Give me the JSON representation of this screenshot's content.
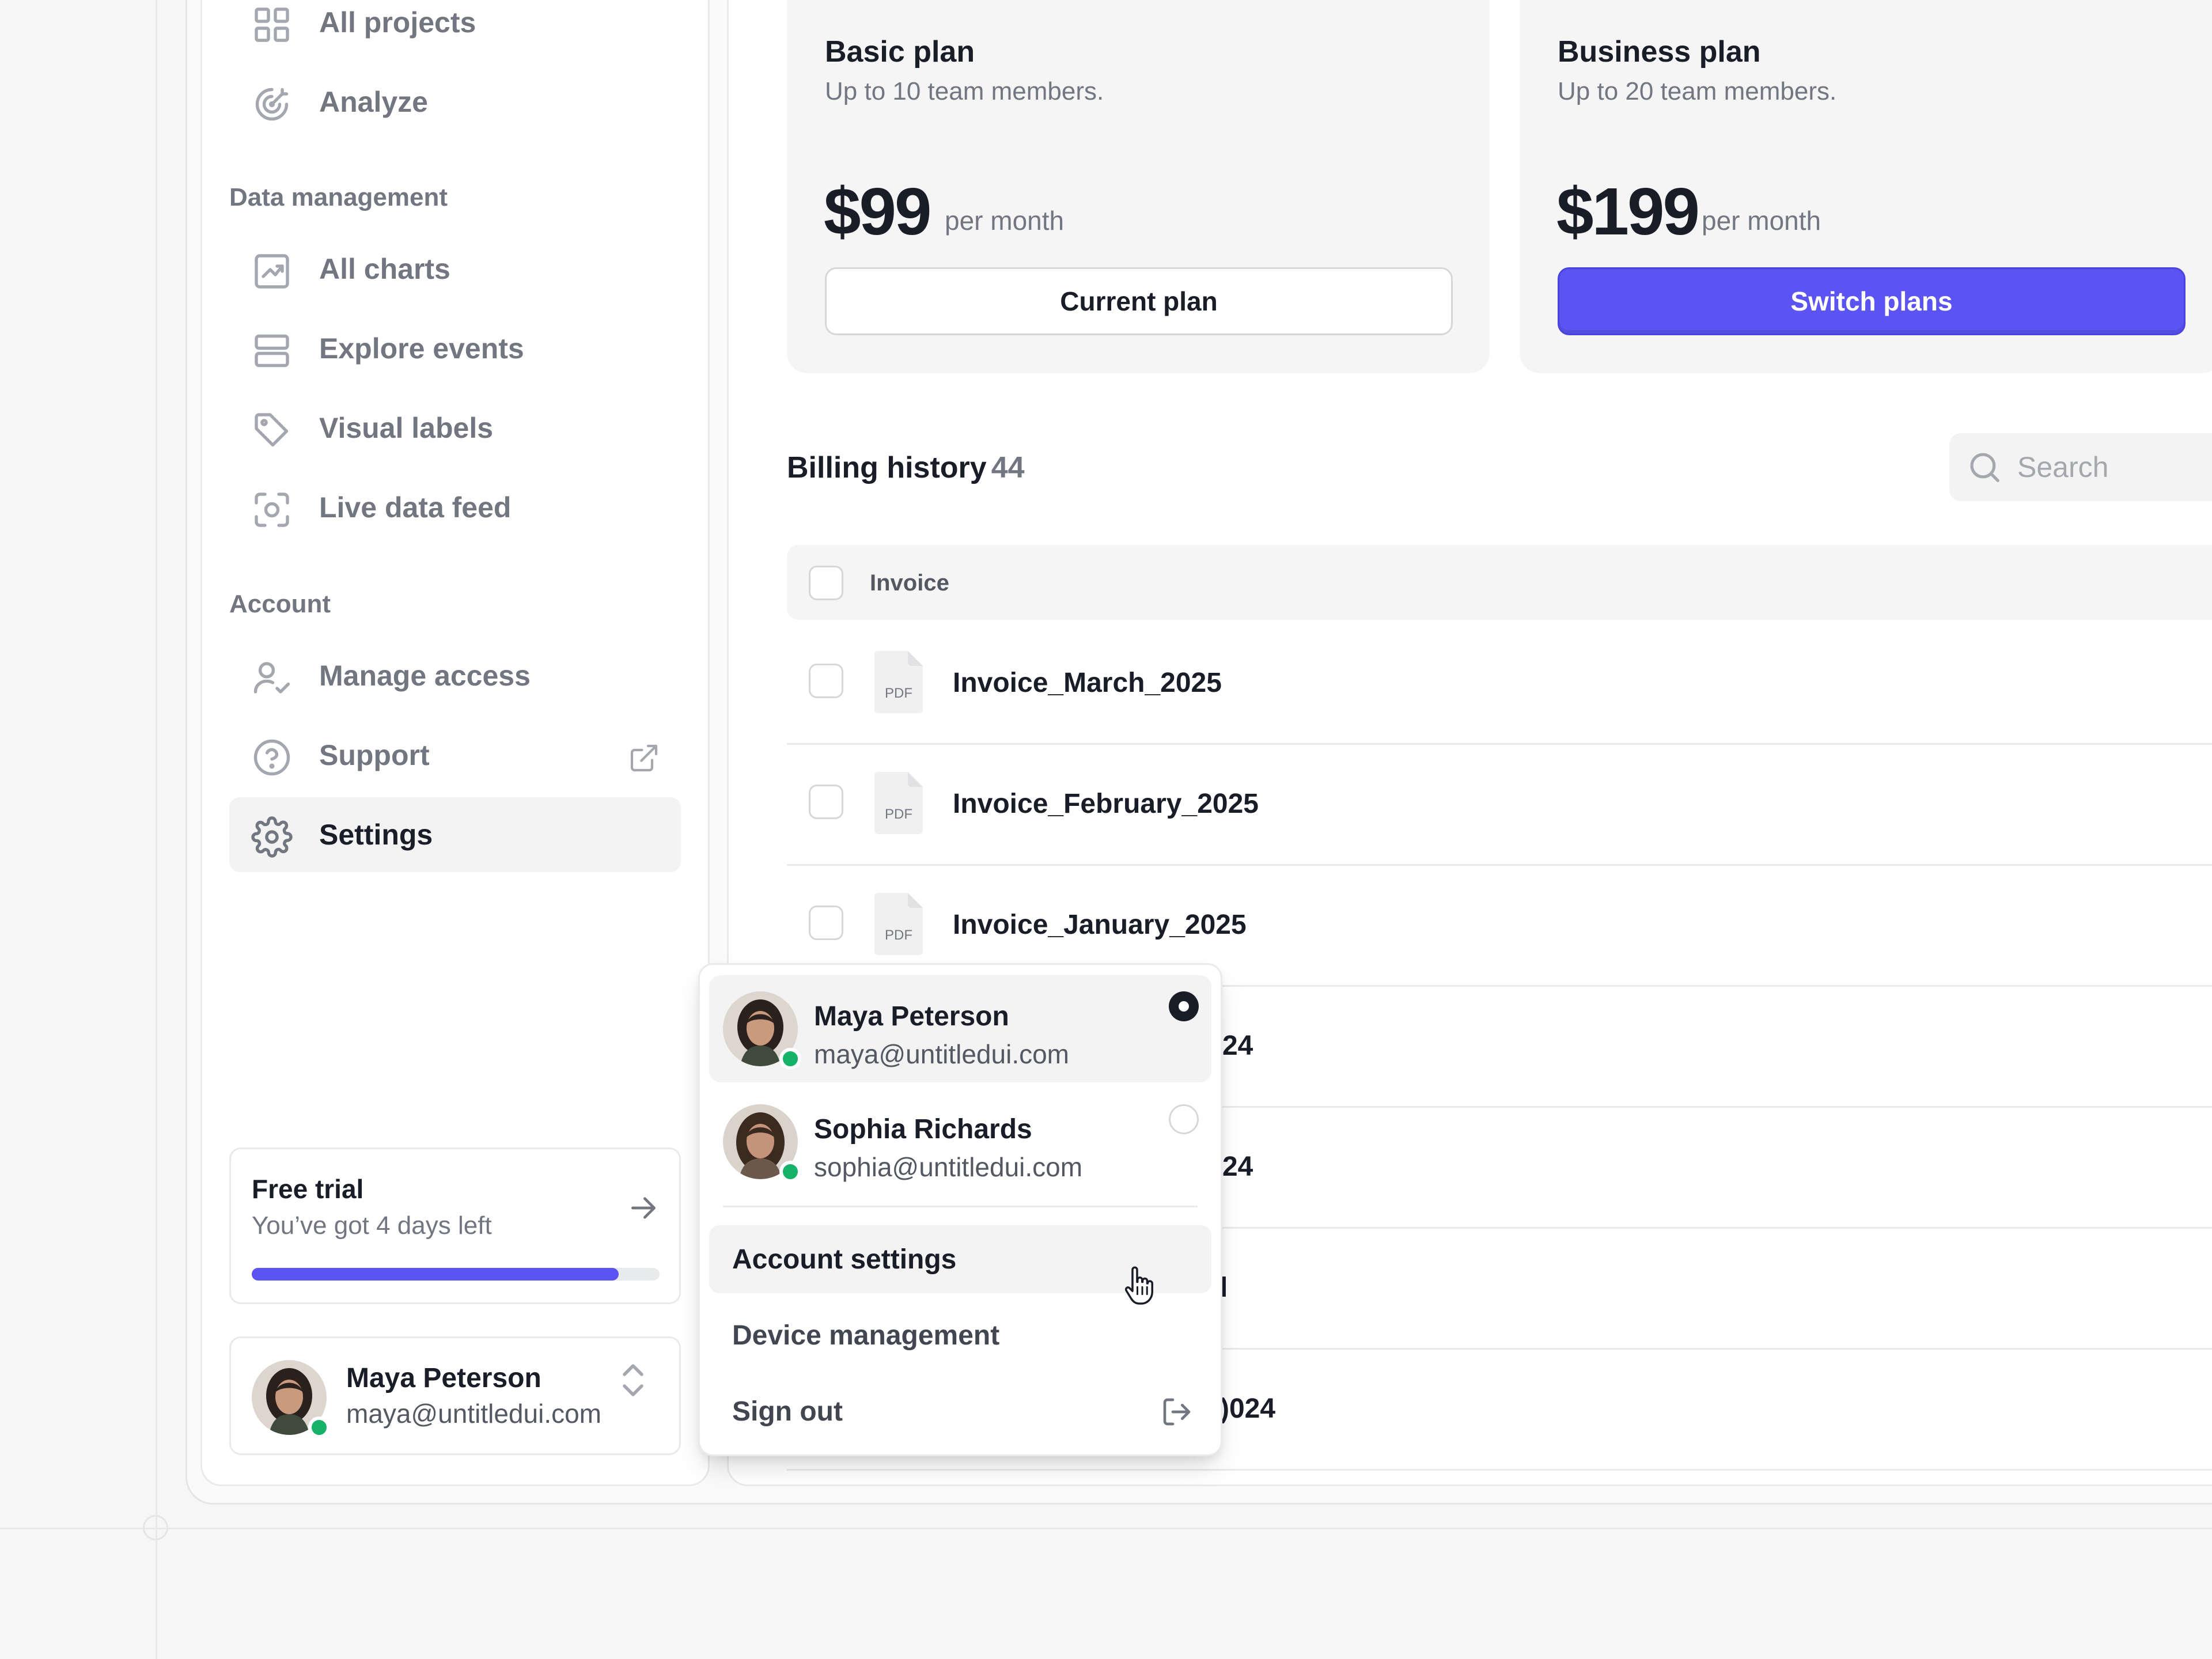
{
  "sidebar": {
    "nav_top": [
      {
        "label": "All projects",
        "icon": "grid-icon"
      },
      {
        "label": "Analyze",
        "icon": "target-icon"
      }
    ],
    "sections": [
      {
        "title": "Data management",
        "items": [
          {
            "label": "All charts",
            "icon": "chart-icon"
          },
          {
            "label": "Explore events",
            "icon": "rows-icon"
          },
          {
            "label": "Visual labels",
            "icon": "tag-icon"
          },
          {
            "label": "Live data feed",
            "icon": "focus-icon"
          }
        ]
      },
      {
        "title": "Account",
        "items": [
          {
            "label": "Manage access",
            "icon": "user-check-icon"
          },
          {
            "label": "Support",
            "icon": "help-circle-icon"
          },
          {
            "label": "Settings",
            "icon": "gear-icon",
            "active": true
          }
        ]
      }
    ],
    "trial": {
      "title": "Free trial",
      "subtitle": "You’ve got 4 days left",
      "progress": 0.9
    },
    "user": {
      "name": "Maya Peterson",
      "email": "maya@untitledui.com"
    }
  },
  "plans": [
    {
      "title": "Basic plan",
      "subtitle": "Up to 10 team members.",
      "price": "$99",
      "period": "per month",
      "button": "Current plan"
    },
    {
      "title": "Business plan",
      "subtitle": "Up to 20 team members.",
      "price": "$199",
      "period": "per month",
      "button": "Switch plans"
    }
  ],
  "billing": {
    "title": "Billing history",
    "count": "44",
    "search_placeholder": "Search",
    "column_invoice": "Invoice",
    "rows": [
      {
        "file_type": "PDF",
        "name": "Invoice_March_2025"
      },
      {
        "file_type": "PDF",
        "name": "Invoice_February_2025"
      },
      {
        "file_type": "PDF",
        "name": "Invoice_January_2025"
      },
      {
        "name": ")24"
      },
      {
        "name": ")24"
      },
      {
        "name": "l"
      },
      {
        "name": ")024"
      }
    ]
  },
  "dropdown": {
    "accounts": [
      {
        "name": "Maya Peterson",
        "email": "maya@untitledui.com",
        "selected": true
      },
      {
        "name": "Sophia Richards",
        "email": "sophia@untitledui.com",
        "selected": false
      }
    ],
    "items": [
      {
        "label": "Account settings"
      },
      {
        "label": "Device management"
      },
      {
        "label": "Sign out"
      }
    ]
  },
  "colors": {
    "primary": "#5b54f3",
    "online": "#17b26a",
    "text_primary": "#181d27",
    "text_muted": "#717680"
  }
}
